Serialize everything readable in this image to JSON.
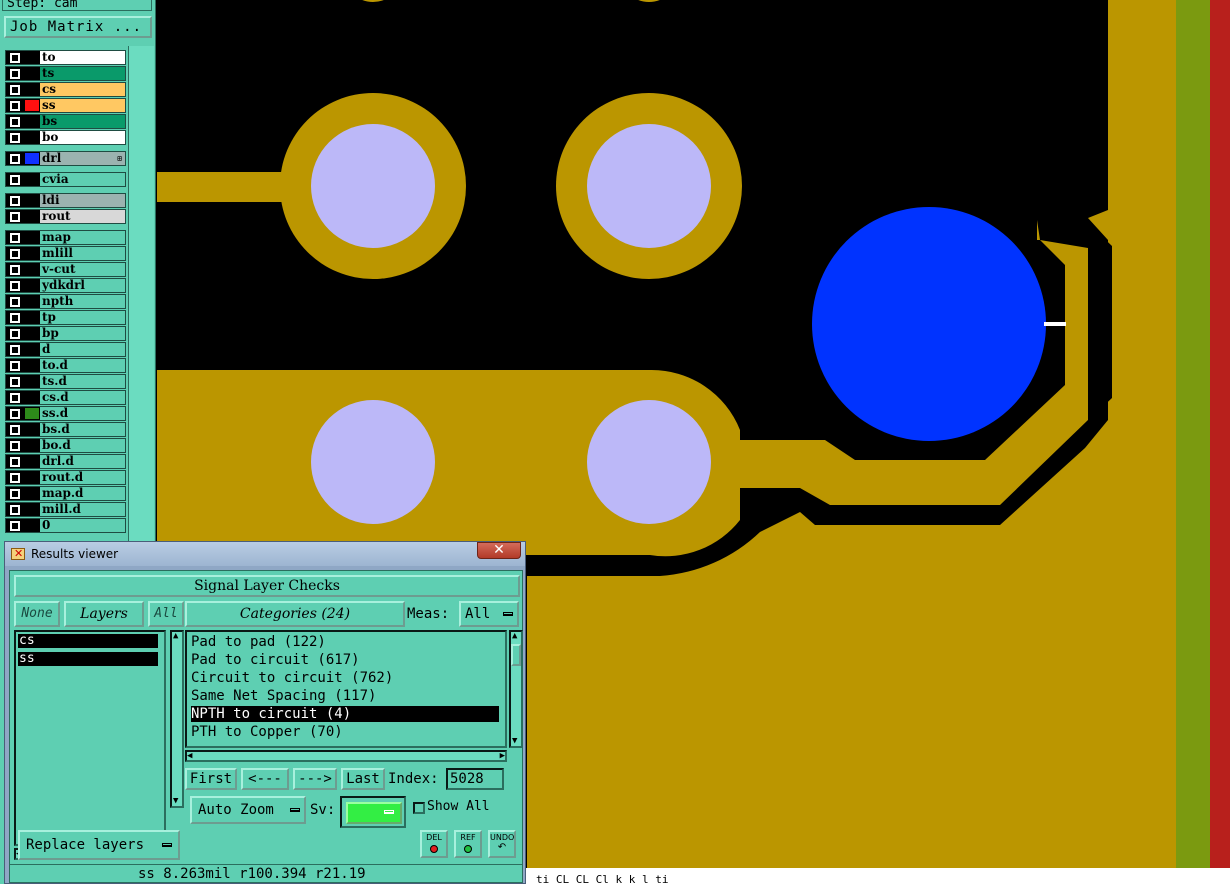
{
  "step_label": "Step: cam",
  "job_matrix_label": "Job Matrix ...",
  "colors": {
    "copper": "#bb9600",
    "background": "#000000",
    "pad_hole": "#bcb8f8",
    "highlight": "#0033ff",
    "panel": "#5ecfb2",
    "border_green": "#7b9a10",
    "border_red": "#b8201c"
  },
  "layers": [
    {
      "name": "to",
      "swatch": "#000000",
      "bg": "#ffffff"
    },
    {
      "name": "ts",
      "swatch": "#000000",
      "bg": "#0a9a6a"
    },
    {
      "name": "cs",
      "swatch": "#000000",
      "bg": "#ffc862"
    },
    {
      "name": "ss",
      "swatch": "#ff1010",
      "bg": "#ffc862"
    },
    {
      "name": "bs",
      "swatch": "#000000",
      "bg": "#0a9a6a"
    },
    {
      "name": "bo",
      "swatch": "#000000",
      "bg": "#ffffff"
    },
    {
      "name": "drl",
      "swatch": "#1030ff",
      "bg": "#9bb3b0",
      "mark": "⊞"
    },
    {
      "name": "cvia",
      "swatch": "#000000",
      "bg": "#5ecfb2"
    },
    {
      "name": "ldi",
      "swatch": "#000000",
      "bg": "#9bb3b0"
    },
    {
      "name": "rout",
      "swatch": "#000000",
      "bg": "#d8d8d8"
    },
    {
      "name": "map",
      "swatch": "#000000",
      "bg": "#5ecfb2"
    },
    {
      "name": "mlill",
      "swatch": "#000000",
      "bg": "#5ecfb2"
    },
    {
      "name": "v-cut",
      "swatch": "#000000",
      "bg": "#5ecfb2"
    },
    {
      "name": "ydkdrl",
      "swatch": "#000000",
      "bg": "#5ecfb2"
    },
    {
      "name": "npth",
      "swatch": "#000000",
      "bg": "#5ecfb2"
    },
    {
      "name": "tp",
      "swatch": "#000000",
      "bg": "#5ecfb2"
    },
    {
      "name": "bp",
      "swatch": "#000000",
      "bg": "#5ecfb2"
    },
    {
      "name": "d",
      "swatch": "#000000",
      "bg": "#5ecfb2"
    },
    {
      "name": "to.d",
      "swatch": "#000000",
      "bg": "#5ecfb2"
    },
    {
      "name": "ts.d",
      "swatch": "#000000",
      "bg": "#5ecfb2"
    },
    {
      "name": "cs.d",
      "swatch": "#000000",
      "bg": "#5ecfb2"
    },
    {
      "name": "ss.d",
      "swatch": "#2d8a1a",
      "bg": "#5ecfb2"
    },
    {
      "name": "bs.d",
      "swatch": "#000000",
      "bg": "#5ecfb2"
    },
    {
      "name": "bo.d",
      "swatch": "#000000",
      "bg": "#5ecfb2"
    },
    {
      "name": "drl.d",
      "swatch": "#000000",
      "bg": "#5ecfb2"
    },
    {
      "name": "rout.d",
      "swatch": "#000000",
      "bg": "#5ecfb2"
    },
    {
      "name": "map.d",
      "swatch": "#000000",
      "bg": "#5ecfb2"
    },
    {
      "name": "mill.d",
      "swatch": "#000000",
      "bg": "#5ecfb2"
    },
    {
      "name": "0",
      "swatch": "#000000",
      "bg": "#5ecfb2"
    }
  ],
  "results_viewer": {
    "title": "Results viewer",
    "close_label": "✕",
    "heading": "Signal Layer Checks",
    "none_label": "None",
    "layers_label": "Layers",
    "all_label": "All",
    "categories_label": "Categories (24)",
    "meas_label": "Meas:",
    "meas_value": "All",
    "selected_layers": [
      "cs",
      "ss"
    ],
    "categories": [
      {
        "label": "Pad to pad (122)",
        "selected": false
      },
      {
        "label": "Pad to circuit (617)",
        "selected": false
      },
      {
        "label": "Circuit to circuit (762)",
        "selected": false
      },
      {
        "label": "Same Net Spacing (117)",
        "selected": false
      },
      {
        "label": "NPTH to circuit (4)",
        "selected": true
      },
      {
        "label": "PTH to Copper (70)",
        "selected": false
      }
    ],
    "first_label": "First",
    "prev_label": "<---",
    "next_label": "--->",
    "last_label": "Last",
    "index_label": "Index:",
    "index_value": "5028",
    "auto_zoom_label": "Auto Zoom",
    "sv_label": "Sv:",
    "show_all_label": "Show All",
    "replace_layers_label": "Replace layers",
    "del_label": "DEL",
    "ref_label": "REF",
    "undo_label": "UNDO",
    "status": "ss 8.263mil  r100.394  r21.19"
  },
  "bottom_strip_text": "ti     CL CL Cl k k  l  ti"
}
